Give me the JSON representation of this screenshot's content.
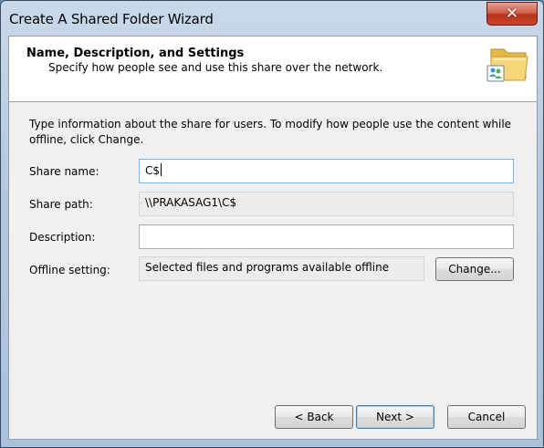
{
  "window": {
    "title": "Create A Shared Folder Wizard",
    "close_glyph": "✕"
  },
  "header": {
    "title": "Name, Description, and Settings",
    "subtitle": "Specify how people see and use this share over the network.",
    "icon": "shared-folder-icon"
  },
  "intro": "Type information about the share for users. To modify how people use the content while offline, click Change.",
  "form": {
    "share_name": {
      "label": "Share name:",
      "value": "C$"
    },
    "share_path": {
      "label": "Share path:",
      "value": "\\\\PRAKASAG1\\C$"
    },
    "description": {
      "label": "Description:",
      "value": ""
    },
    "offline_setting": {
      "label": "Offline setting:",
      "value": "Selected files and programs available offline",
      "change_label": "Change..."
    }
  },
  "buttons": {
    "back": "< Back",
    "next": "Next >",
    "cancel": "Cancel"
  },
  "colors": {
    "close_button": "#c9452a",
    "focus_border": "#7eb4ea",
    "default_button_border": "#3c7fb1"
  }
}
